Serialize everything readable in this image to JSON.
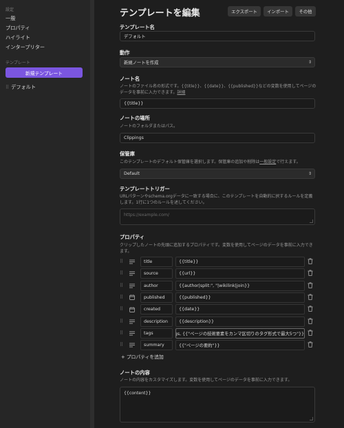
{
  "sidebar": {
    "settings_header": "設定",
    "items": [
      "一般",
      "プロパティ",
      "ハイライト",
      "インタープリター"
    ],
    "templates_header": "テンプレート",
    "new_template_button": "新規テンプレート",
    "templates": [
      "デフォルト"
    ]
  },
  "header": {
    "title": "テンプレートを編集",
    "export_button": "エクスポート",
    "import_button": "インポート",
    "more_button": "その他"
  },
  "template_name": {
    "label": "テンプレート名",
    "value": "デフォルト"
  },
  "behavior": {
    "label": "動作",
    "value": "新規ノートを作成"
  },
  "note_name": {
    "label": "ノート名",
    "description": "ノートのファイル名の形式です。{{title}}、{{date}}、{{published}}などの変数を使用してページのデータを事前に入力できます。",
    "link": "詳細",
    "value": "{{title}}"
  },
  "note_location": {
    "label": "ノートの場所",
    "description": "ノートのフォルダまたはパス。",
    "value": "Clippings"
  },
  "vault": {
    "label": "保管庫",
    "description_before": "このテンプレートのデフォルト保管庫を選択します。保管庫の追加や削除は",
    "link": "一般設定",
    "description_after": "で行えます。",
    "value": "Default"
  },
  "triggers": {
    "label": "テンプレートトリガー",
    "description": "URLパターンやschema.orgデータに一致する場合に、このテンプレートを自動的に択するルールを定義します。1行に1つのルールを述してください。",
    "placeholder": "https://example.com/"
  },
  "properties": {
    "label": "プロパティ",
    "description": "クリップしたノートの先頭に追加するプロパティです。変数を使用してページのデータを事前に入力できます。",
    "rows": [
      {
        "name": "title",
        "value": "{{title}}",
        "type_icon": "list-icon"
      },
      {
        "name": "source",
        "value": "{{url}}",
        "type_icon": "list-icon"
      },
      {
        "name": "author",
        "value": "{{author|split:\", \"|wikilink|join}}",
        "type_icon": "list-icon"
      },
      {
        "name": "published",
        "value": "{{published}}",
        "type_icon": "calendar-icon"
      },
      {
        "name": "created",
        "value": "{{date}}",
        "type_icon": "calendar-icon"
      },
      {
        "name": "description",
        "value": "{{description}}",
        "type_icon": "list-icon"
      },
      {
        "name": "tags",
        "value": "igs, {{\"ページの技術要素をカンマ区切りのタグ形式で最大5つ\"}}",
        "type_icon": "list-icon"
      },
      {
        "name": "summary",
        "value": "{{\"ページの要約\"}}",
        "type_icon": "list-icon"
      }
    ],
    "add_button": "+ プロパティを追加"
  },
  "note_content": {
    "label": "ノートの内容",
    "description": "ノートの内容をカスタマイズします。変数を使用してページのデータを事前に入力できます。",
    "value": "{{content}}"
  },
  "colors": {
    "accent": "#7b56e0",
    "background": "#1e1e1e",
    "sidebar": "#262626"
  }
}
